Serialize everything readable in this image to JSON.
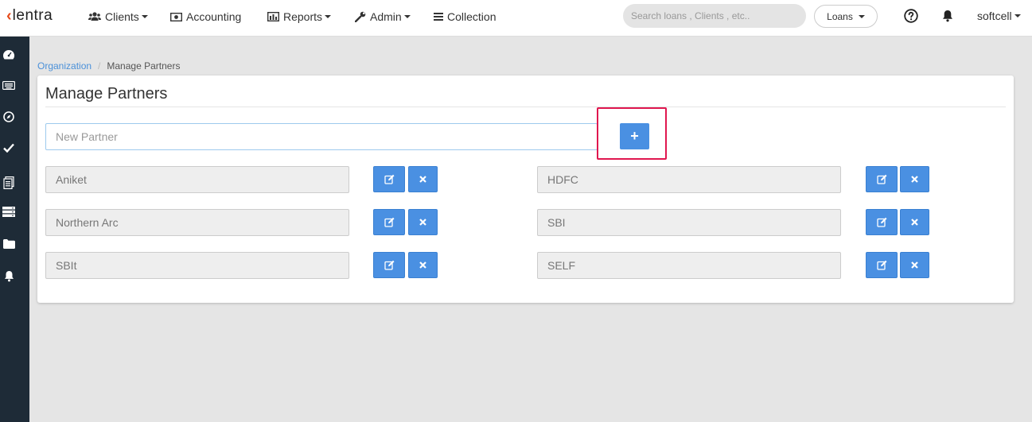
{
  "app": {
    "logo_text": "lentra"
  },
  "nav": {
    "clients": "Clients",
    "accounting": "Accounting",
    "reports": "Reports",
    "admin": "Admin",
    "collection": "Collection"
  },
  "search": {
    "placeholder": "Search loans , Clients , etc.."
  },
  "loans_dropdown": {
    "label": "Loans"
  },
  "user": {
    "name": "softcell"
  },
  "breadcrumb": {
    "parent": "Organization",
    "current": "Manage Partners"
  },
  "page": {
    "title": "Manage Partners",
    "new_partner_placeholder": "New Partner",
    "add_button": "+"
  },
  "partners": [
    {
      "name": "Aniket"
    },
    {
      "name": "HDFC"
    },
    {
      "name": "Northern Arc"
    },
    {
      "name": "SBI"
    },
    {
      "name": "SBIt"
    },
    {
      "name": "SELF"
    }
  ],
  "colors": {
    "accent": "#4a90e2",
    "highlight": "#e0174f",
    "sidebar": "#1e2b37",
    "logo_mark": "#e64a19"
  }
}
